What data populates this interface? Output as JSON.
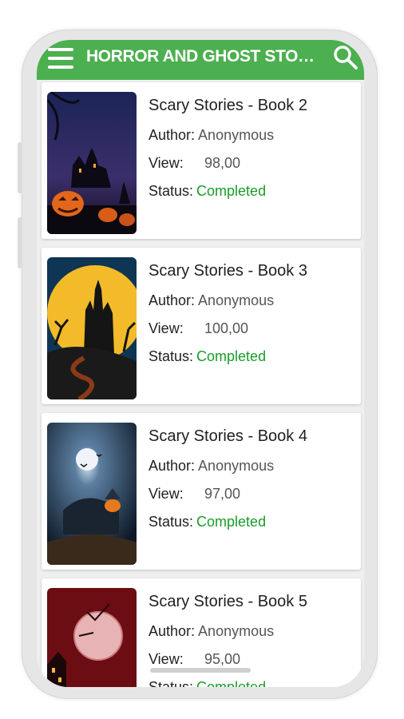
{
  "appbar": {
    "title": "HORROR AND GHOST STORI...",
    "menu_icon": "hamburger-menu-icon",
    "search_icon": "search-icon",
    "color": "#4caf50"
  },
  "labels": {
    "author": "Author:",
    "view": "View:",
    "status": "Status:"
  },
  "books": [
    {
      "title": "Scary Stories - Book 2",
      "author": "Anonymous",
      "view": "98,00",
      "status": "Completed"
    },
    {
      "title": "Scary Stories - Book 3",
      "author": "Anonymous",
      "view": "100,00",
      "status": "Completed"
    },
    {
      "title": "Scary Stories - Book 4",
      "author": "Anonymous",
      "view": "97,00",
      "status": "Completed"
    },
    {
      "title": "Scary Stories - Book 5",
      "author": "Anonymous",
      "view": "95,00",
      "status": "Completed"
    }
  ],
  "colors": {
    "status_completed": "#1a9c2a"
  }
}
